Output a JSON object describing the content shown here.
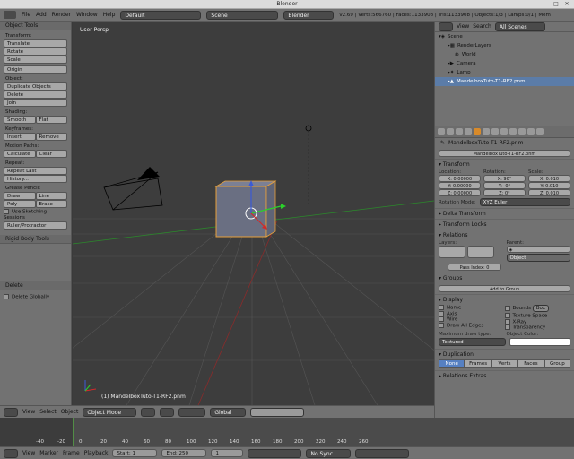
{
  "window": {
    "title": "Blender"
  },
  "topbar": {
    "menus": [
      "File",
      "Add",
      "Render",
      "Window",
      "Help"
    ],
    "layout": "Default",
    "scene": "Scene",
    "engine": "Blender Render",
    "stats": "v2.69 | Verts:566760 | Faces:1133908 | Tris:1133908 | Objects:1/3 | Lamps:0/1 | Mem"
  },
  "toolshelf": {
    "title": "Object Tools",
    "transform_label": "Transform:",
    "translate": "Translate",
    "rotate": "Rotate",
    "scale": "Scale",
    "origin": "Origin",
    "object_label": "Object:",
    "duplicate": "Duplicate Objects",
    "delete": "Delete",
    "join": "Join",
    "shading_label": "Shading:",
    "smooth": "Smooth",
    "flat": "Flat",
    "keyframes_label": "Keyframes:",
    "insert": "Insert",
    "remove": "Remove",
    "motion_label": "Motion Paths:",
    "calculate": "Calculate",
    "clear": "Clear",
    "repeat_label": "Repeat:",
    "repeat_last": "Repeat Last",
    "history": "History...",
    "grease_label": "Grease Pencil:",
    "draw": "Draw",
    "line": "Line",
    "poly": "Poly",
    "erase": "Erase",
    "use_sketching": "Use Sketching Sessions",
    "ruler": "Ruler/Protractor",
    "rigid": "Rigid Body Tools",
    "delete_panel": "Delete",
    "delete_globally": "Delete Globally"
  },
  "viewport": {
    "label": "User Persp",
    "object_label": "(1) MandelboxTuto-T1-RF2.pnm"
  },
  "vpheader": {
    "view": "View",
    "select": "Select",
    "object": "Object",
    "mode": "Object Mode",
    "orientation": "Global"
  },
  "timeline": {
    "ticks": [
      "-40",
      "-20",
      "0",
      "20",
      "40",
      "60",
      "80",
      "100",
      "120",
      "140",
      "160",
      "180",
      "200",
      "220",
      "240",
      "260"
    ],
    "view": "View",
    "marker": "Marker",
    "frame": "Frame",
    "playback": "Playback",
    "start": "Start: 1",
    "end": "End: 250",
    "current": "1",
    "sync": "No Sync"
  },
  "outliner": {
    "view": "View",
    "search": "Search",
    "filter": "All Scenes",
    "items": [
      "Scene",
      "RenderLayers",
      "World",
      "Camera",
      "Lamp",
      "MandelboxTuto-T1-RF2.pnm"
    ]
  },
  "properties": {
    "breadcrumb": "MandelboxTuto-T1-RF2.pnm",
    "name": "MandelboxTuto-T1-RF2.pnm",
    "transform": "Transform",
    "location": "Location:",
    "rotation": "Rotation:",
    "scale": "Scale:",
    "loc": [
      "X: 0.00000",
      "Y: 0.00000",
      "Z: 0.00000"
    ],
    "rot": [
      "X: 90°",
      "Y: -0°",
      "Z: 0°"
    ],
    "scl": [
      "X: 0.010",
      "Y: 0.010",
      "Z: 0.010"
    ],
    "rotation_mode_label": "Rotation Mode:",
    "rotation_mode": "XYZ Euler",
    "delta": "Delta Transform",
    "locks": "Transform Locks",
    "relations": "Relations",
    "layers": "Layers:",
    "parent": "Parent:",
    "parent_type": "Object",
    "pass_index": "Pass Index: 0",
    "groups": "Groups",
    "add_group": "Add to Group",
    "display": "Display",
    "name_chk": "Name",
    "axis": "Axis",
    "wire": "Wire",
    "draw_all": "Draw All Edges",
    "bounds": "Bounds",
    "bounds_type": "Box",
    "tex_space": "Texture Space",
    "xray": "X-Ray",
    "transparency": "Transparency",
    "max_draw": "Maximum draw type:",
    "obj_color": "Object Color:",
    "draw_type": "Textured",
    "duplication": "Duplication",
    "dup_opts": [
      "None",
      "Frames",
      "Verts",
      "Faces",
      "Group"
    ],
    "rel_extras": "Relations Extras"
  }
}
